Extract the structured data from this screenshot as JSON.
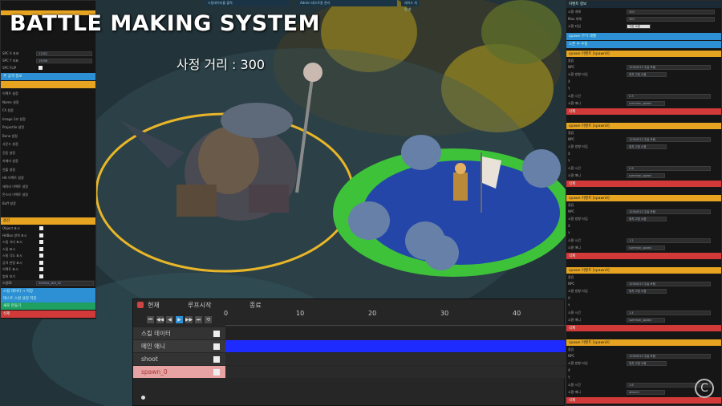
{
  "title": "BATTLE MAKING SYSTEM",
  "distance_label": "사정 거리 : 300",
  "top_windows": [
    "스킬데이터를 출력",
    "Admin 테스트용 관리",
    "레이드 게임 창"
  ],
  "left_panel": {
    "fields": [
      {
        "label": "SPC X 좌표",
        "value": "11552"
      },
      {
        "label": "SPC Y 좌표",
        "value": "15096"
      }
    ],
    "flip_label": "SPC FLIP",
    "blue_header": "주 공격 정보",
    "items": [
      "이펙트 설정",
      "Name 설정",
      "FX 설정",
      "Image 1st 설정",
      "Projectile 설정",
      "Bone 설정",
      "사운드 설정",
      "진동 설정",
      "카메라 설정",
      "연출 설정",
      "Hit 이펙트 설정",
      "캐릭터 이펙트 설정",
      "몬스터 이펙트 설정",
      "Buff 설정"
    ],
    "orange_header": "옵션",
    "checks": [
      "Object 표시",
      "HitBox 영역 표시",
      "스킬 거리 표시",
      "스킬 표시",
      "스킬 각도 표시",
      "공격 판정 표시",
      "이펙트 표시",
      "범위 보기"
    ],
    "id_label": "스킬ID",
    "id_value": "300042_skill_02",
    "buttons": [
      "스킬 데이터 → 저장",
      "테스트 스킬 설정 저장",
      "새로 만들기",
      "삭제"
    ]
  },
  "right_panel": {
    "header": "이벤트 정보",
    "top_fields": [
      {
        "label": "소환 개체",
        "value": "300"
      },
      {
        "label": "Max 개체",
        "value": "300"
      },
      {
        "label": "소환 타입",
        "value": "기본 소환"
      }
    ],
    "blue_rows": [
      "spawn 무기 레벨",
      "스폰 수 수정"
    ],
    "event_title": "spawn 이벤트 [spawn0]",
    "blocks": [
      {
        "npc": "10364013 주술 토템",
        "type": "위치 고정 소환",
        "time": "0.3",
        "name": "summon_spawn"
      },
      {
        "npc": "10364013 주술 토템",
        "type": "위치 고정 소환",
        "time": "0.6",
        "name": "summon_spawn"
      },
      {
        "npc": "10364013 주술 토템",
        "type": "위치 고정 소환",
        "time": "1.2",
        "name": "summon_spawn"
      },
      {
        "npc": "10364013 주술 토템",
        "type": "위치 고정 소환",
        "time": "1.4",
        "name": "summon_spawn"
      },
      {
        "npc": "10364013 주술 토템",
        "type": "위치 고정 소환",
        "time": "1.6",
        "name": "attack1"
      }
    ],
    "row_labels": {
      "kind": "종류",
      "npc": "NPC",
      "type": "소환 방향 타입",
      "x": "X",
      "y": "Y",
      "time": "소환 시간",
      "name": "소환 애니"
    },
    "delete_label": "삭제"
  },
  "timeline": {
    "tab_now": "현재",
    "tab_loop": "루프시작",
    "tab_end": "종료",
    "ticks": [
      "0",
      "10",
      "20",
      "30",
      "40"
    ],
    "rows": [
      {
        "label": "스킬 데이터",
        "track_color": "#222222"
      },
      {
        "label": "메인 애니",
        "track_color": "#1e2bff"
      },
      {
        "label": "shoot",
        "track_color": "#2a2a2a"
      },
      {
        "label": "spawn_0",
        "track_color": "#2a2a2a"
      }
    ],
    "buttons": [
      "⏮",
      "◀◀",
      "◀",
      "▶",
      "▶▶",
      "⏭",
      "⟲"
    ]
  },
  "logo": "C"
}
